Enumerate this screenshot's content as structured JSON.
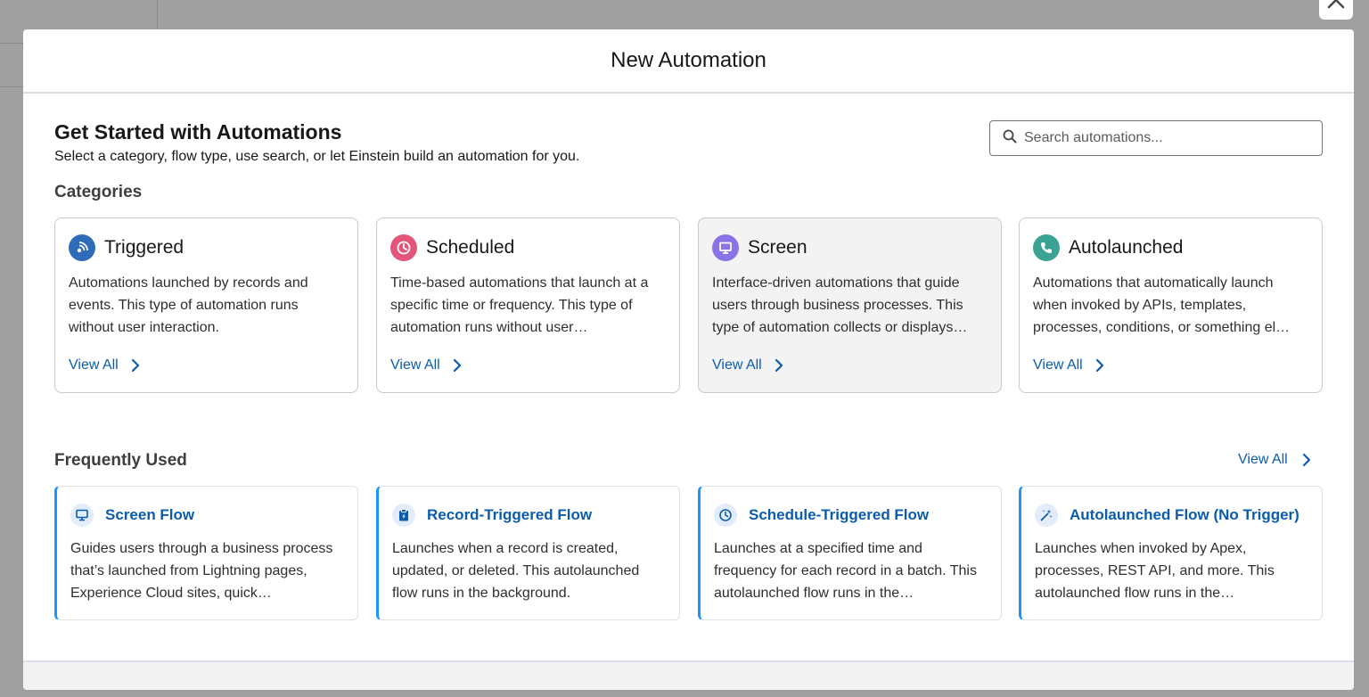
{
  "modal": {
    "title": "New Automation",
    "close_icon": "close-icon"
  },
  "intro": {
    "title": "Get Started with Automations",
    "subtitle": "Select a category, flow type, use search, or let Einstein build an automation for you."
  },
  "search": {
    "placeholder": "Search automations...",
    "value": "",
    "icon": "search-icon"
  },
  "categories": {
    "heading": "Categories",
    "view_all_label": "View All",
    "items": [
      {
        "name": "Triggered",
        "description": "Automations launched by records and events. This type of automation runs without user interaction.",
        "icon": "rss-icon",
        "color": "#2e6bb8"
      },
      {
        "name": "Scheduled",
        "description": "Time-based automations that launch at a specific time or frequency. This type of automation runs without user…",
        "icon": "clock-icon",
        "color": "#e3567a"
      },
      {
        "name": "Screen",
        "description": "Interface-driven automations that guide users through business processes. This type of automation collects or displays…",
        "icon": "monitor-icon",
        "color": "#8a73e6"
      },
      {
        "name": "Autolaunched",
        "description": "Automations that automatically launch when invoked by APIs, templates, processes, conditions, or something el…",
        "icon": "phone-icon",
        "color": "#3ba394"
      }
    ]
  },
  "frequently_used": {
    "heading": "Frequently Used",
    "view_all_label": "View All",
    "items": [
      {
        "name": "Screen Flow",
        "description": "Guides users through a business process that’s launched from Lightning pages, Experience Cloud sites, quick…",
        "icon": "monitor-icon"
      },
      {
        "name": "Record-Triggered Flow",
        "description": "Launches when a record is created, updated, or deleted. This autolaunched flow runs in the background.",
        "icon": "clipboard-bolt-icon"
      },
      {
        "name": "Schedule-Triggered Flow",
        "description": "Launches at a specified time and frequency for each record in a batch. This autolaunched flow runs in the…",
        "icon": "clock-icon"
      },
      {
        "name": "Autolaunched Flow (No Trigger)",
        "description": "Launches when invoked by Apex, processes, REST API, and more. This autolaunched flow runs in the…",
        "icon": "magic-wand-icon"
      }
    ]
  },
  "colors": {
    "link": "#0b5cab",
    "accent_border": "#1b96ff",
    "overlay": "#a0a0a0"
  }
}
